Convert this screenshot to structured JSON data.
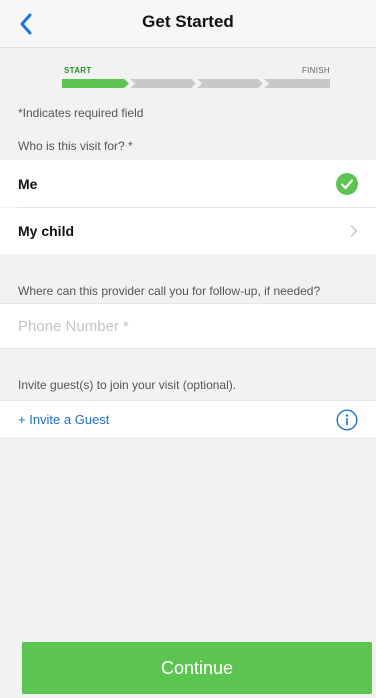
{
  "nav": {
    "title": "Get Started",
    "back_icon": "chevron-left-icon"
  },
  "progress": {
    "start_label": "START",
    "finish_label": "FINISH",
    "total_steps": 4,
    "completed_steps": 1,
    "active_color": "#5cc451",
    "inactive_color": "#c8c8c8"
  },
  "required_note": "*Indicates required field",
  "patient": {
    "question": "Who is this visit for? *",
    "options": [
      {
        "label": "Me",
        "selected": true,
        "icon": "check-circle-icon"
      },
      {
        "label": "My child",
        "selected": false,
        "icon": "chevron-right-icon"
      }
    ]
  },
  "phone": {
    "question": "Where can this provider call you for follow-up, if needed?",
    "placeholder": "Phone Number *",
    "value": ""
  },
  "guest": {
    "question": "Invite guest(s) to join your visit (optional).",
    "invite_label": "+ Invite a Guest",
    "info_icon": "info-icon"
  },
  "continue_label": "Continue",
  "colors": {
    "accent_green": "#5cc451",
    "link_blue": "#1e6fc8",
    "nav_blue": "#1a73e8"
  }
}
